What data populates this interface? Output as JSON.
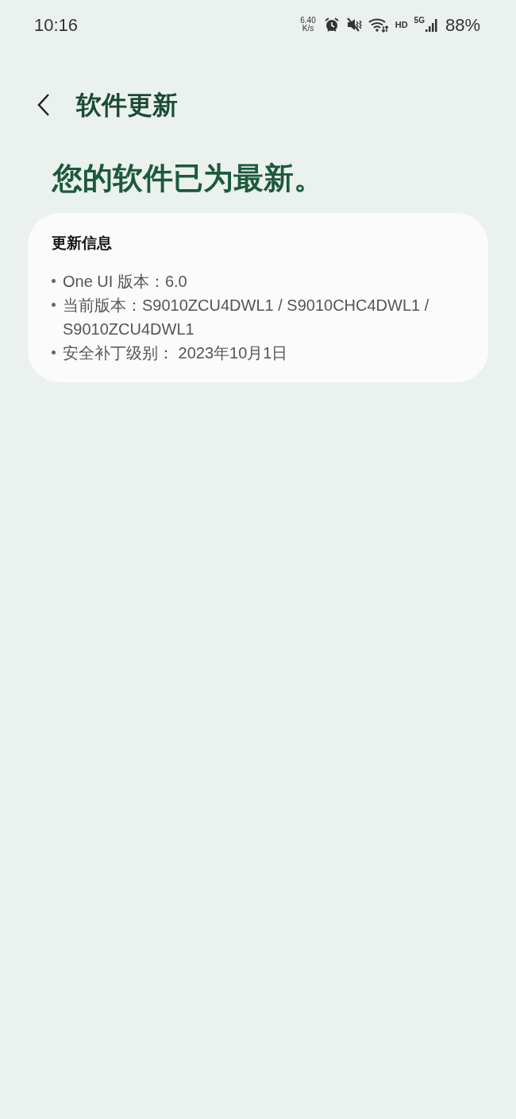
{
  "status_bar": {
    "time": "10:16",
    "net_speed": "6.40",
    "net_unit": "K/s",
    "hd": "HD",
    "network": "5G",
    "battery": "88%"
  },
  "header": {
    "title": "软件更新"
  },
  "headline": "您的软件已为最新。",
  "card": {
    "title": "更新信息",
    "items": [
      {
        "text": "One UI 版本：6.0"
      },
      {
        "text": "当前版本：S9010ZCU4DWL1 / S9010CHC4DWL1 / S9010ZCU4DWL1"
      },
      {
        "text": "安全补丁级别： 2023年10月1日"
      }
    ]
  }
}
